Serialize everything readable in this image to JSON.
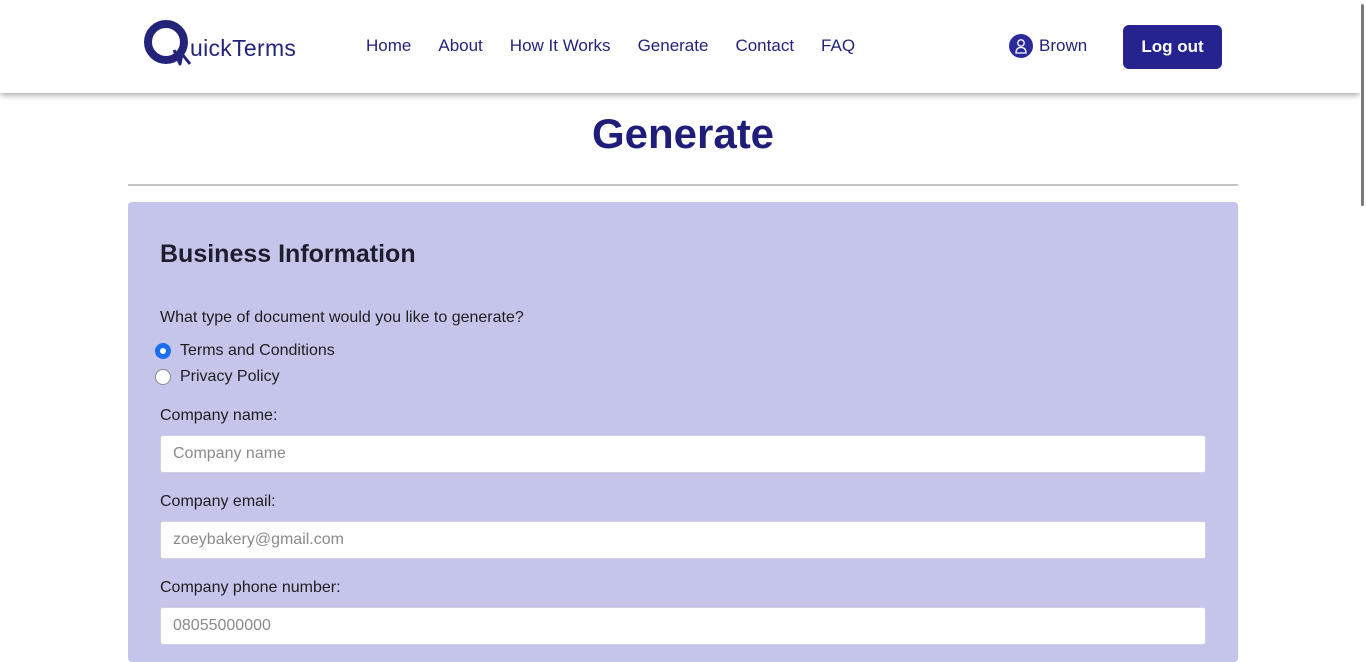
{
  "brand": {
    "logo_text": "uickTerms",
    "logo_letter": "Q"
  },
  "nav": {
    "links": [
      "Home",
      "About",
      "How It Works",
      "Generate",
      "Contact",
      "FAQ"
    ],
    "user_name": "Brown",
    "logout_label": "Log out"
  },
  "page": {
    "title": "Generate"
  },
  "form": {
    "section_title": "Business Information",
    "question": "What type of document would you like to generate?",
    "options": [
      {
        "label": "Terms and Conditions",
        "selected": true
      },
      {
        "label": "Privacy Policy",
        "selected": false
      }
    ],
    "fields": [
      {
        "label": "Company name:",
        "placeholder": "Company name"
      },
      {
        "label": "Company email:",
        "placeholder": "zoeybakery@gmail.com"
      },
      {
        "label": "Company phone number:",
        "placeholder": "08055000000"
      }
    ]
  },
  "colors": {
    "brand": "#23237a",
    "button": "#24238f",
    "card_bg": "#c5c5ec",
    "radio_selected": "#1a6ef0"
  },
  "icons": {
    "user": "user-icon",
    "logo": "q-logo-icon"
  }
}
